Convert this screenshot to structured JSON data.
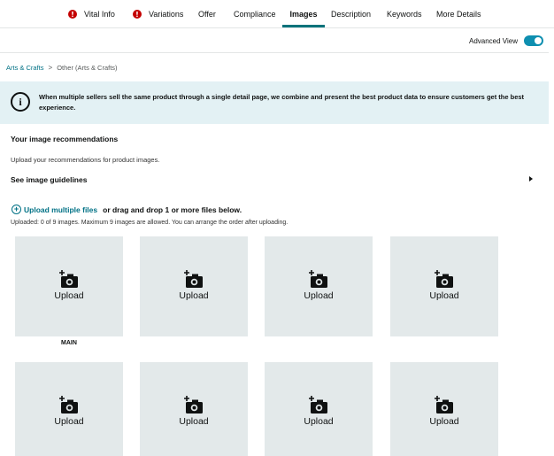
{
  "tabs": [
    {
      "label": "Vital Info",
      "error": true
    },
    {
      "label": "Variations",
      "error": true
    },
    {
      "label": "Offer",
      "error": false
    },
    {
      "label": "Compliance",
      "error": false
    },
    {
      "label": "Images",
      "error": false,
      "active": true
    },
    {
      "label": "Description",
      "error": false
    },
    {
      "label": "Keywords",
      "error": false
    },
    {
      "label": "More Details",
      "error": false
    }
  ],
  "advanced_view": {
    "label": "Advanced View",
    "enabled": true
  },
  "breadcrumb": {
    "link": "Arts & Crafts",
    "separator": ">",
    "current": "Other (Arts & Crafts)"
  },
  "info_banner": {
    "text": "When multiple sellers sell the same product through a single detail page, we combine and present the best product data to ensure customers get the best experience."
  },
  "recommendations": {
    "title": "Your image recommendations",
    "subtitle": "Upload your recommendations for product images.",
    "guidelines_label": "See image guidelines"
  },
  "upload": {
    "link_label": "Upload multiple files",
    "rest_label": "or drag and drop 1 or more files below.",
    "status": "Uploaded: 0 of 9 images. Maximum 9 images are allowed. You can arrange the order after uploading."
  },
  "tiles": [
    {
      "label": "Upload",
      "caption": "MAIN"
    },
    {
      "label": "Upload"
    },
    {
      "label": "Upload"
    },
    {
      "label": "Upload"
    },
    {
      "label": "Upload"
    },
    {
      "label": "Upload"
    },
    {
      "label": "Upload"
    },
    {
      "label": "Upload"
    }
  ],
  "colors": {
    "accent": "#00727b",
    "link": "#007185",
    "error": "#c40000",
    "banner": "#e3f1f4",
    "tile": "#e3e9ea",
    "toggle": "#0e8fb0"
  }
}
